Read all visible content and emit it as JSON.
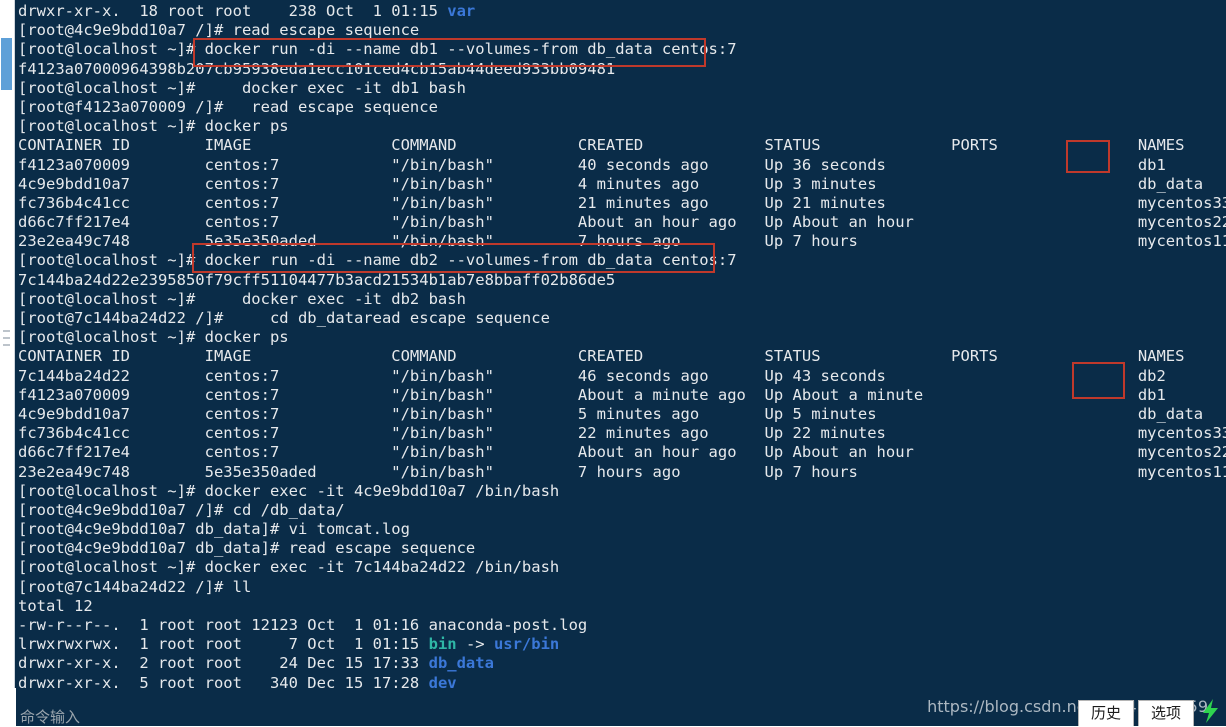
{
  "window": {
    "background_color": "#0a2c48",
    "foreground_color": "#e6e9ec",
    "accent_red": "#c0392b"
  },
  "scrollbar": {
    "name": "vertical-scrollbar"
  },
  "terminal": {
    "lines": [
      {
        "id": "l01",
        "segments": [
          {
            "t": "drwxr-xr-x.  18 root root    238 Oct  1 01:15 ",
            "c": ""
          },
          {
            "t": "var",
            "c": "c-blue"
          }
        ]
      },
      {
        "id": "l02",
        "segments": [
          {
            "t": "[root@4c9e9bdd10a7 /]# read escape sequence",
            "c": ""
          }
        ]
      },
      {
        "id": "l03",
        "segments": [
          {
            "t": "[root@localhost ~]# docker run -di --name db1 --volumes-from db_data centos:7",
            "c": ""
          }
        ]
      },
      {
        "id": "l04",
        "segments": [
          {
            "t": "f4123a07000964398b207cb95938eda1ecc101ced4cb15ab44deed933bb09481",
            "c": ""
          }
        ]
      },
      {
        "id": "l05",
        "segments": [
          {
            "t": "[root@localhost ~]#     docker exec -it db1 bash",
            "c": ""
          }
        ]
      },
      {
        "id": "l06",
        "segments": [
          {
            "t": "[root@f4123a070009 /]#   read escape sequence",
            "c": ""
          }
        ]
      },
      {
        "id": "l07",
        "segments": [
          {
            "t": "[root@localhost ~]# docker ps",
            "c": ""
          }
        ]
      },
      {
        "id": "l08",
        "segments": [
          {
            "t": "CONTAINER ID        IMAGE               COMMAND             CREATED             STATUS              PORTS               NAMES",
            "c": ""
          }
        ]
      },
      {
        "id": "l09",
        "segments": [
          {
            "t": "f4123a070009        centos:7            \"/bin/bash\"         40 seconds ago      Up 36 seconds                           db1",
            "c": ""
          }
        ]
      },
      {
        "id": "l10",
        "segments": [
          {
            "t": "4c9e9bdd10a7        centos:7            \"/bin/bash\"         4 minutes ago       Up 3 minutes                            db_data",
            "c": ""
          }
        ]
      },
      {
        "id": "l11",
        "segments": [
          {
            "t": "fc736b4c41cc        centos:7            \"/bin/bash\"         21 minutes ago      Up 21 minutes                           mycentos33",
            "c": ""
          }
        ]
      },
      {
        "id": "l12",
        "segments": [
          {
            "t": "d66c7ff217e4        centos:7            \"/bin/bash\"         About an hour ago   Up About an hour                        mycentos22",
            "c": ""
          }
        ]
      },
      {
        "id": "l13",
        "segments": [
          {
            "t": "23e2ea49c748        5e35e350aded        \"/bin/bash\"         7 hours ago         Up 7 hours                              mycentos11",
            "c": ""
          }
        ]
      },
      {
        "id": "l14",
        "segments": [
          {
            "t": "[root@localhost ~]# docker run -di --name db2 --volumes-from db_data centos:7",
            "c": ""
          }
        ]
      },
      {
        "id": "l15",
        "segments": [
          {
            "t": "7c144ba24d22e2395850f79cff51104477b3acd21534b1ab7e8bbaff02b86de5",
            "c": ""
          }
        ]
      },
      {
        "id": "l16",
        "segments": [
          {
            "t": "[root@localhost ~]#     docker exec -it db2 bash",
            "c": ""
          }
        ]
      },
      {
        "id": "l17",
        "segments": [
          {
            "t": "[root@7c144ba24d22 /]#     cd db_dataread escape sequence",
            "c": ""
          }
        ]
      },
      {
        "id": "l18",
        "segments": [
          {
            "t": "[root@localhost ~]# docker ps",
            "c": ""
          }
        ]
      },
      {
        "id": "l19",
        "segments": [
          {
            "t": "CONTAINER ID        IMAGE               COMMAND             CREATED             STATUS              PORTS               NAMES",
            "c": ""
          }
        ]
      },
      {
        "id": "l20",
        "segments": [
          {
            "t": "7c144ba24d22        centos:7            \"/bin/bash\"         46 seconds ago      Up 43 seconds                           db2",
            "c": ""
          }
        ]
      },
      {
        "id": "l21",
        "segments": [
          {
            "t": "f4123a070009        centos:7            \"/bin/bash\"         About a minute ago  Up About a minute                       db1",
            "c": ""
          }
        ]
      },
      {
        "id": "l22",
        "segments": [
          {
            "t": "4c9e9bdd10a7        centos:7            \"/bin/bash\"         5 minutes ago       Up 5 minutes                            db_data",
            "c": ""
          }
        ]
      },
      {
        "id": "l23",
        "segments": [
          {
            "t": "fc736b4c41cc        centos:7            \"/bin/bash\"         22 minutes ago      Up 22 minutes                           mycentos33",
            "c": ""
          }
        ]
      },
      {
        "id": "l24",
        "segments": [
          {
            "t": "d66c7ff217e4        centos:7            \"/bin/bash\"         About an hour ago   Up About an hour                        mycentos22",
            "c": ""
          }
        ]
      },
      {
        "id": "l25",
        "segments": [
          {
            "t": "23e2ea49c748        5e35e350aded        \"/bin/bash\"         7 hours ago         Up 7 hours                              mycentos11",
            "c": ""
          }
        ]
      },
      {
        "id": "l26",
        "segments": [
          {
            "t": "[root@localhost ~]# docker exec -it 4c9e9bdd10a7 /bin/bash",
            "c": ""
          }
        ]
      },
      {
        "id": "l27",
        "segments": [
          {
            "t": "[root@4c9e9bdd10a7 /]# cd /db_data/",
            "c": ""
          }
        ]
      },
      {
        "id": "l28",
        "segments": [
          {
            "t": "[root@4c9e9bdd10a7 db_data]# vi tomcat.log",
            "c": ""
          }
        ]
      },
      {
        "id": "l29",
        "segments": [
          {
            "t": "[root@4c9e9bdd10a7 db_data]# read escape sequence",
            "c": ""
          }
        ]
      },
      {
        "id": "l30",
        "segments": [
          {
            "t": "[root@localhost ~]# docker exec -it 7c144ba24d22 /bin/bash",
            "c": ""
          }
        ]
      },
      {
        "id": "l31",
        "segments": [
          {
            "t": "[root@7c144ba24d22 /]# ll",
            "c": ""
          }
        ]
      },
      {
        "id": "l32",
        "segments": [
          {
            "t": "total 12",
            "c": ""
          }
        ]
      },
      {
        "id": "l33",
        "segments": [
          {
            "t": "-rw-r--r--.  1 root root 12123 Oct  1 01:16 anaconda-post.log",
            "c": ""
          }
        ]
      },
      {
        "id": "l34",
        "segments": [
          {
            "t": "lrwxrwxrwx.  1 root root     7 Oct  1 01:15 ",
            "c": ""
          },
          {
            "t": "bin",
            "c": "c-teal"
          },
          {
            "t": " -> ",
            "c": ""
          },
          {
            "t": "usr/bin",
            "c": "c-blue"
          }
        ]
      },
      {
        "id": "l35",
        "segments": [
          {
            "t": "drwxr-xr-x.  2 root root    24 Dec 15 17:33 ",
            "c": ""
          },
          {
            "t": "db_data",
            "c": "c-blue"
          }
        ]
      },
      {
        "id": "l36",
        "segments": [
          {
            "t": "drwxr-xr-x.  5 root root   340 Dec 15 17:28 ",
            "c": ""
          },
          {
            "t": "dev",
            "c": "c-blue"
          }
        ]
      }
    ]
  },
  "annotations": {
    "box_command_db1": "docker run -di --name db1 --volumes-from db_data centos:7",
    "box_command_db2": "docker run -di --name db2 --volumes-from db_data centos:7",
    "box_names_first": "db1",
    "box_names_second": "db2 / db1"
  },
  "bottom_bar": {
    "command_input_label": "命令输入",
    "watermark": "https://blog.csdn.net/qq_45174759",
    "history_button": "历史",
    "options_button": "选项",
    "bolt_icon_color": "#2fd44f"
  }
}
